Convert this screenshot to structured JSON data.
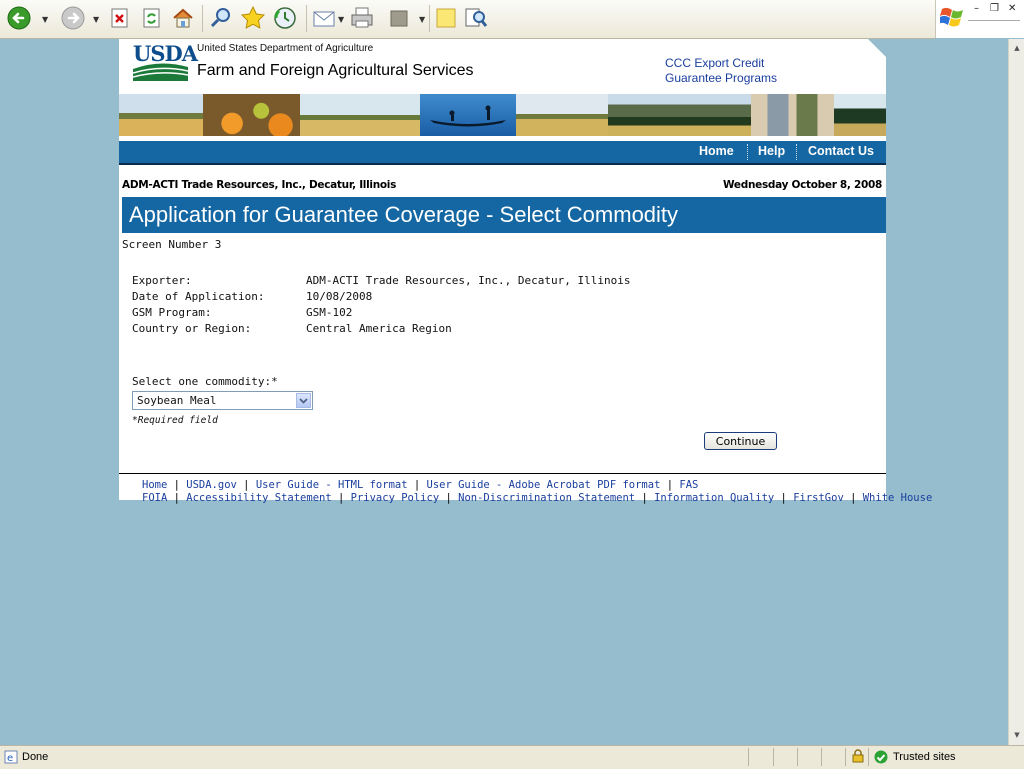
{
  "toolbar": {
    "buttons": [
      "back",
      "forward",
      "stop",
      "refresh",
      "home",
      "search",
      "favorites",
      "history",
      "mail",
      "print",
      "edit",
      "discuss",
      "research"
    ]
  },
  "header": {
    "usda": "USDA",
    "department": "United States Department of Agriculture",
    "site_title": "Farm and Foreign Agricultural Services",
    "ccc_line1": "CCC Export Credit",
    "ccc_line2": "Guarantee Programs"
  },
  "nav": {
    "home": "Home",
    "help": "Help",
    "contact": "Contact Us"
  },
  "context": {
    "exporter_line": "ADM-ACTI Trade Resources, Inc., Decatur, Illinois",
    "date": "Wednesday October 8, 2008"
  },
  "page": {
    "title": "Application for Guarantee Coverage - Select Commodity",
    "screen_number": "Screen Number 3"
  },
  "info": [
    {
      "label": "Exporter:",
      "value": "ADM-ACTI Trade Resources, Inc., Decatur, Illinois"
    },
    {
      "label": "Date of Application:",
      "value": "10/08/2008"
    },
    {
      "label": "GSM Program:",
      "value": "GSM-102"
    },
    {
      "label": "Country or Region:",
      "value": "Central America Region"
    }
  ],
  "form": {
    "select_label": "Select one commodity:*",
    "selected_commodity": "Soybean Meal",
    "required_note": "*Required field",
    "continue_label": "Continue"
  },
  "footer": {
    "row1": [
      "Home",
      "USDA.gov",
      "User Guide - HTML format",
      "User Guide - Adobe Acrobat PDF format",
      "FAS"
    ],
    "row2": [
      "FOIA",
      "Accessibility Statement",
      "Privacy Policy",
      "Non-Discrimination Statement",
      "Information Quality",
      "FirstGov",
      "White House"
    ]
  },
  "status": {
    "text": "Done",
    "zone": "Trusted sites"
  },
  "colors": {
    "nav_blue": "#1467a2",
    "page_bg": "#95bdce",
    "link_blue": "#1a3e9e"
  }
}
